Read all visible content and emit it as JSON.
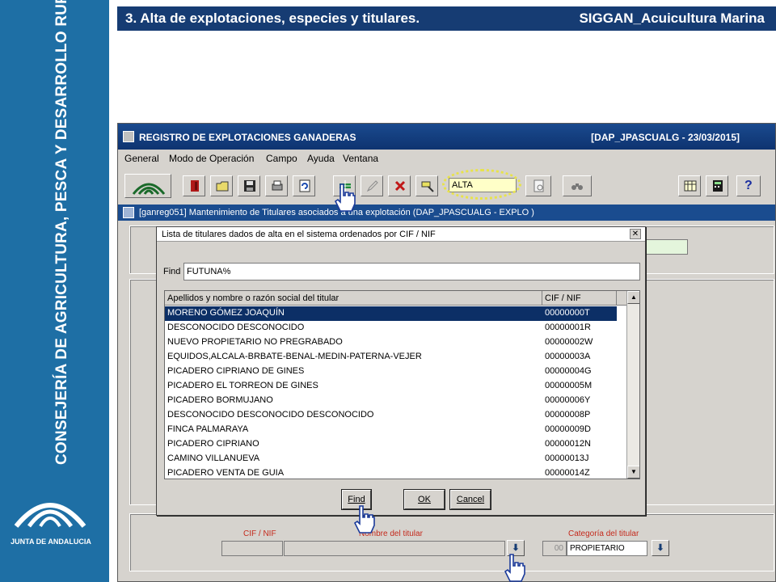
{
  "slide": {
    "sidebar_title": "CONSEJERÍA DE AGRICULTURA, PESCA Y DESARROLLO RURAL",
    "sidebar_org": "JUNTA DE ANDALUCIA",
    "header_left": "3. Alta de explotaciones, especies y titulares.",
    "header_right": "SIGGAN_Acuicultura Marina"
  },
  "app": {
    "title": "REGISTRO DE EXPLOTACIONES GANADERAS",
    "title_right": "[DAP_JPASCUALG - 23/03/2015]",
    "menu": [
      "General",
      "Modo de Operación",
      "Campo",
      "Ayuda",
      "Ventana"
    ],
    "mode_value": "ALTA",
    "subwindow_title": "[ganreg051] Mantenimiento de Titulares asociados a una explotación (DAP_JPASCUALG - EXPLO )",
    "toolbar_icons": [
      "app-logo-icon",
      "exit-icon",
      "open-folder-icon",
      "save-icon",
      "print-icon",
      "refresh-icon",
      "insert-record-icon",
      "edit-pencil-icon",
      "delete-icon",
      "tool-icon",
      "mode-query-icon",
      "binoculars-icon",
      "calendar-icon",
      "calculator-icon",
      "help-icon"
    ]
  },
  "dialog": {
    "title": "Lista de titulares dados de alta en el sistema ordenados por CIF / NIF",
    "close_symbol": "✕",
    "find_label": "Find",
    "find_value": "FUTUNA%",
    "columns": [
      "Apellidos y nombre o razón social del titular",
      "CIF / NIF"
    ],
    "rows": [
      {
        "name": "MORENO GÓMEZ JOAQUÍN",
        "nif": "00000000T"
      },
      {
        "name": "DESCONOCIDO  DESCONOCIDO",
        "nif": "00000001R"
      },
      {
        "name": "NUEVO PROPIETARIO NO PREGRABADO",
        "nif": "00000002W"
      },
      {
        "name": "EQUIDOS,ALCALA-BRBATE-BENAL-MEDIN-PATERNA-VEJER",
        "nif": "00000003A"
      },
      {
        "name": "PICADERO CIPRIANO DE GINES",
        "nif": "00000004G"
      },
      {
        "name": "PICADERO EL TORREON DE GINES",
        "nif": "00000005M"
      },
      {
        "name": "PICADERO BORMUJANO",
        "nif": "00000006Y"
      },
      {
        "name": "DESCONOCIDO DESCONOCIDO DESCONOCIDO",
        "nif": "00000008P"
      },
      {
        "name": "FINCA PALMARAYA",
        "nif": "00000009D"
      },
      {
        "name": "PICADERO CIPRIANO",
        "nif": "00000012N"
      },
      {
        "name": "CAMINO VILLANUEVA",
        "nif": "00000013J"
      },
      {
        "name": "PICADERO VENTA DE GUIA",
        "nif": "00000014Z"
      }
    ],
    "selected_index": 0,
    "buttons": {
      "find": "Find",
      "ok": "OK",
      "cancel": "Cancel"
    }
  },
  "form": {
    "cif_label": "CIF / NIF",
    "nombre_label": "Nombre del titular",
    "categoria_label": "Categoría del titular",
    "categoria_code": "00",
    "categoria_value": "PROPIETARIO"
  },
  "colors": {
    "sidebar": "#1e6fa5",
    "header": "#163c73",
    "selection": "#0c2f66",
    "label_red": "#c42a1c"
  }
}
